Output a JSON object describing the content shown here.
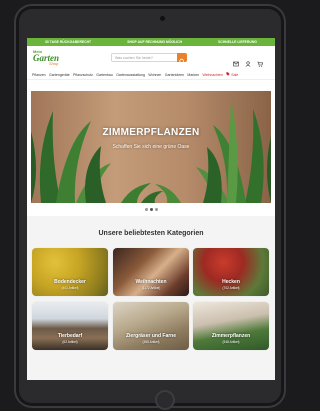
{
  "topbar": {
    "items": [
      "30 TAGE RÜCKGABERECHT",
      "SHOP AUF RECHNUNG MÖGLICH",
      "SCHNELLE LIEFERUNG"
    ]
  },
  "header": {
    "logo_line1": "Mein",
    "logo_line2": "Garten",
    "logo_line3": "Shop",
    "search_placeholder": "Was suchen Sie heute?"
  },
  "nav": {
    "items": [
      "Pflanzen",
      "Gartengeräte",
      "Pflanzschutz",
      "Gartenbau",
      "Gartenausstattung",
      "Wohnen",
      "Gartenideen",
      "Marken",
      "Weihnachten",
      "Sale"
    ]
  },
  "hero": {
    "title": "ZIMMERPFLANZEN",
    "subtitle": "Schaffen Sie sich eine grüne Oase"
  },
  "categories": {
    "title": "Unsere beliebtesten Kategorien",
    "items": [
      {
        "name": "Bodendecker",
        "count": "(401 Artikel)"
      },
      {
        "name": "Weihnachten",
        "count": "(1172 Artikel)"
      },
      {
        "name": "Hecken",
        "count": "(702 Artikel)"
      },
      {
        "name": "Tierbedarf",
        "count": "(62 Artikel)"
      },
      {
        "name": "Ziergräser und Farne",
        "count": "(365 Artikel)"
      },
      {
        "name": "Zimmerpflanzen",
        "count": "(548 Artikel)"
      }
    ]
  },
  "colors": {
    "accent_green": "#6bb43b",
    "accent_orange": "#e8812b",
    "sale_red": "#d6262c"
  }
}
